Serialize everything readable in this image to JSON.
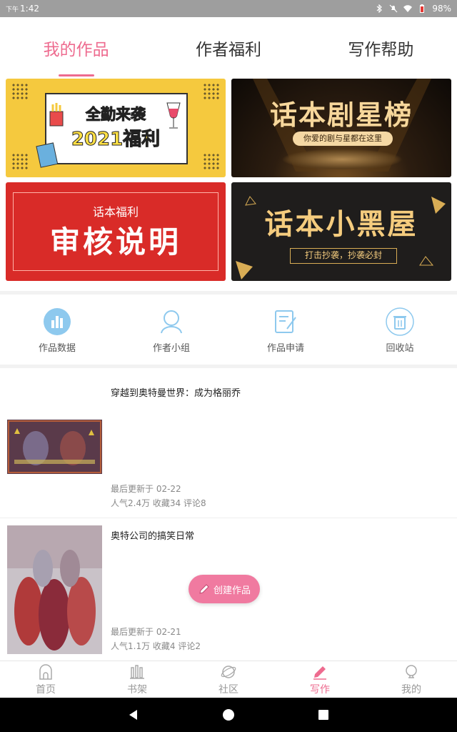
{
  "status_bar": {
    "ampm": "下午",
    "time": "1:42",
    "battery": "98%"
  },
  "top_tabs": [
    {
      "label": "我的作品",
      "active": true
    },
    {
      "label": "作者福利",
      "active": false
    },
    {
      "label": "写作帮助",
      "active": false
    }
  ],
  "banners": {
    "b1": {
      "line1": "全勤来袭",
      "line2": "2021福利"
    },
    "b2": {
      "title": "话本剧星榜",
      "subtitle": "你爱的剧与星都在这里"
    },
    "b3": {
      "small": "话本福利",
      "big": "审核说明"
    },
    "b4": {
      "title": "话本小黑屋",
      "subtitle": "打击抄袭，抄袭必封"
    }
  },
  "menu": [
    {
      "label": "作品数据",
      "icon": "bar-chart-icon"
    },
    {
      "label": "作者小组",
      "icon": "group-icon"
    },
    {
      "label": "作品申请",
      "icon": "edit-document-icon"
    },
    {
      "label": "回收站",
      "icon": "trash-icon"
    }
  ],
  "works": [
    {
      "title": "穿越到奥特曼世界：成为格丽乔",
      "updated": "最后更新于 02-22",
      "stats": "人气2.4万  收藏34  评论8"
    },
    {
      "title": "奥特公司的搞笑日常",
      "updated": "最后更新于 02-21",
      "stats": "人气1.1万  收藏4  评论2"
    }
  ],
  "create_button": "创建作品",
  "bottom_nav": [
    {
      "label": "首页",
      "icon": "home-icon",
      "active": false
    },
    {
      "label": "书架",
      "icon": "bookshelf-icon",
      "active": false
    },
    {
      "label": "社区",
      "icon": "planet-icon",
      "active": false
    },
    {
      "label": "写作",
      "icon": "pen-icon",
      "active": true
    },
    {
      "label": "我的",
      "icon": "profile-icon",
      "active": false
    }
  ],
  "colors": {
    "accent": "#ee6b8f",
    "icon_blue": "#8ec9ee"
  }
}
